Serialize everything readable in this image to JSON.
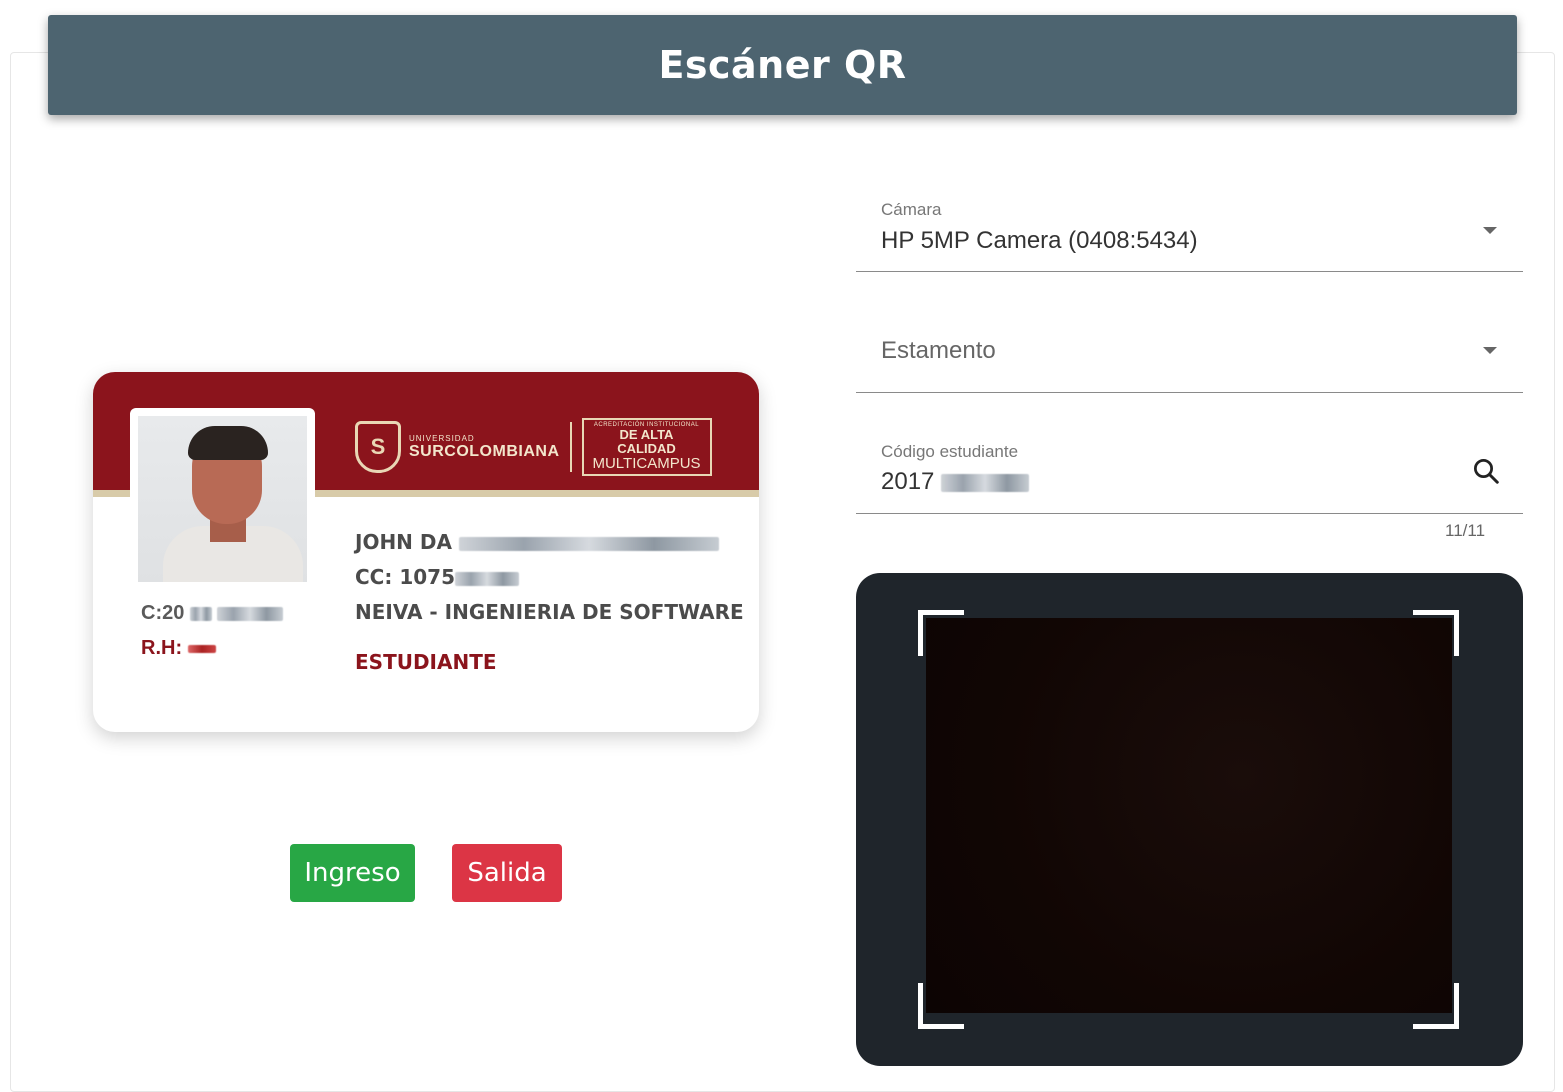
{
  "header": {
    "title": "Escáner QR"
  },
  "id_card": {
    "university_small": "UNIVERSIDAD",
    "university_name": "SURCOLOMBIANA",
    "shield_letter": "S",
    "accreditation_line1": "ACREDITACIÓN INSTITUCIONAL",
    "accreditation_line2": "DE ALTA CALIDAD",
    "accreditation_line3": "MULTICAMPUS",
    "name": "JOHN DA",
    "cc": "CC: 1075",
    "program": "NEIVA - INGENIERIA DE SOFTWARE",
    "role": "ESTUDIANTE",
    "code": "C:20",
    "rh": "R.H:"
  },
  "buttons": {
    "ingreso": "Ingreso",
    "salida": "Salida"
  },
  "form": {
    "camera_label": "Cámara",
    "camera_value": "HP 5MP Camera (0408:5434)",
    "estamento_placeholder": "Estamento",
    "codigo_label": "Código estudiante",
    "codigo_value": "2017",
    "counter": "11/11"
  },
  "colors": {
    "header": "#4d6470",
    "card_band": "#8b141c",
    "ingreso": "#28a745",
    "salida": "#dc3545",
    "camera_bg": "#1f252b"
  }
}
